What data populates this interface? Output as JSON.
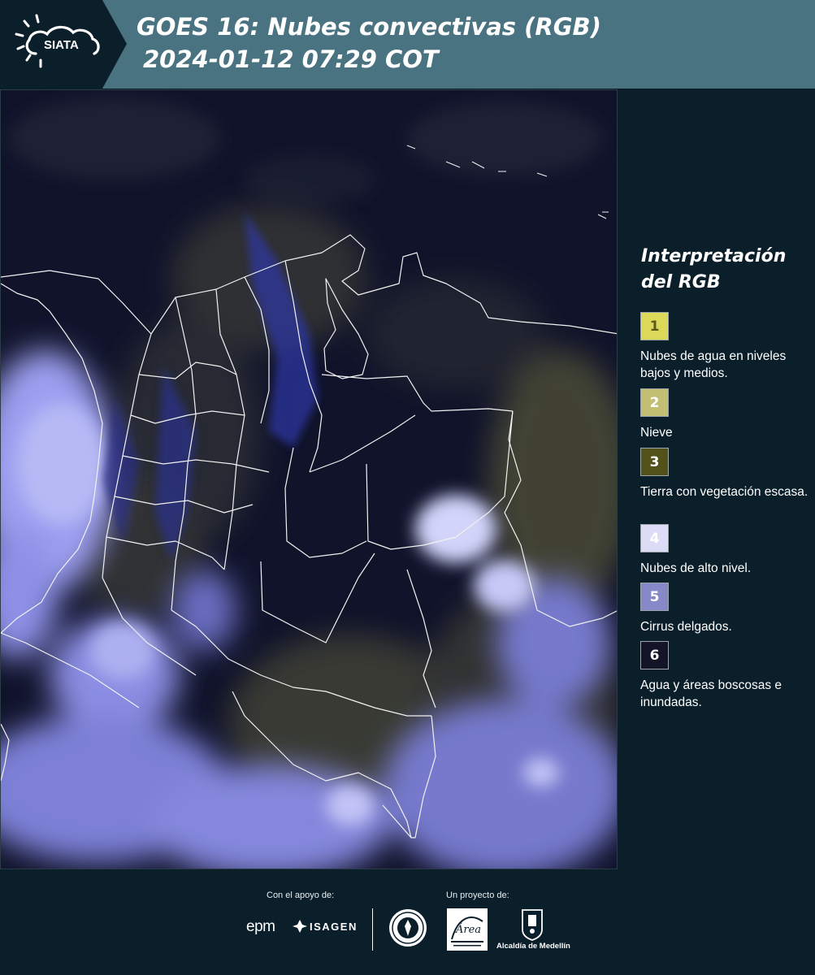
{
  "header": {
    "logo_text": "SIATA",
    "title_line1": "GOES 16: Nubes convectivas (RGB)",
    "title_line2": "2024-01-12 07:29 COT"
  },
  "legend": {
    "title": "Interpretación del RGB",
    "items": [
      {
        "number": "1",
        "label": "Nubes de agua en niveles bajos y medios.",
        "color": "#dcd95a",
        "text_color": "#5b5a1c"
      },
      {
        "number": "2",
        "label": "Nieve",
        "color": "#c2bf72",
        "text_color": "#ffffff"
      },
      {
        "number": "3",
        "label": "Tierra con vegetación escasa.",
        "color": "#54521b",
        "text_color": "#ffffff"
      },
      {
        "number": "4",
        "label": "Nubes de alto nivel.",
        "color": "#dcdcf6",
        "text_color": "#ffffff"
      },
      {
        "number": "5",
        "label": "Cirrus delgados.",
        "color": "#8688c8",
        "text_color": "#ffffff"
      },
      {
        "number": "6",
        "label": "Agua y áreas boscosas e inundadas.",
        "color": "#141428",
        "text_color": "#ffffff"
      }
    ]
  },
  "footer": {
    "support_label": "Con el apoyo de:",
    "project_label": "Un proyecto de:",
    "epm_logo": "epm",
    "isagen_logo": "ISAGEN",
    "area_logo_text": "Área Metropolitana Valle de Aburrá",
    "alcaldia_text": "Alcaldía de Medellín"
  },
  "colors": {
    "header_bg": "#497381",
    "logo_bg": "#0b1f2b",
    "page_bg": "#0b1f2b",
    "map_base": "#10132a",
    "high_cloud": "#a8acf2",
    "low_cloud": "#b8b46a",
    "border_line": "#f2f2f2"
  }
}
